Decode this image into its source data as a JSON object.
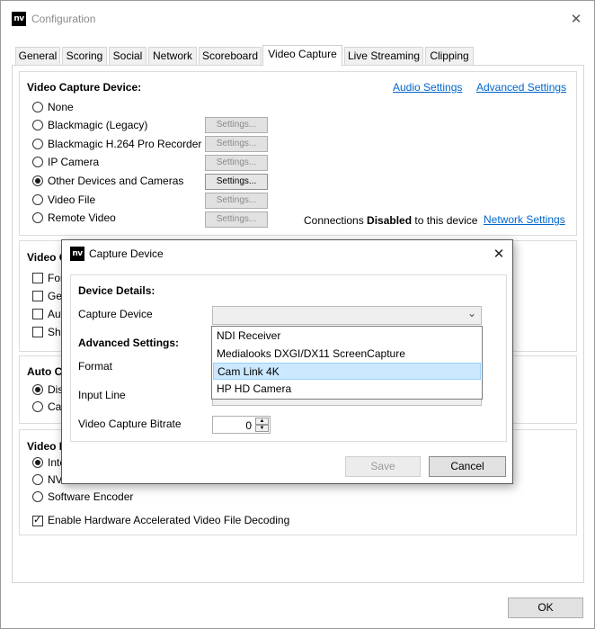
{
  "window": {
    "logo": "nv",
    "title": "Configuration",
    "close_icon": "✕"
  },
  "tabs": [
    "General",
    "Scoring",
    "Social",
    "Network",
    "Scoreboard",
    "Video Capture",
    "Live Streaming",
    "Clipping"
  ],
  "active_tab": "Video Capture",
  "video_capture_device": {
    "title": "Video Capture Device:",
    "audio_settings_link": "Audio Settings",
    "advanced_settings_link": "Advanced Settings",
    "options": [
      {
        "label": "None",
        "selected": false,
        "settings": ""
      },
      {
        "label": "Blackmagic (Legacy)",
        "selected": false,
        "settings": "Settings..."
      },
      {
        "label": "Blackmagic H.264 Pro Recorder",
        "selected": false,
        "settings": "Settings..."
      },
      {
        "label": "IP Camera",
        "selected": false,
        "settings": "Settings..."
      },
      {
        "label": "Other Devices and Cameras",
        "selected": true,
        "settings": "Settings..."
      },
      {
        "label": "Video File",
        "selected": false,
        "settings": "Settings..."
      },
      {
        "label": "Remote Video",
        "selected": false,
        "settings": "Settings..."
      }
    ],
    "connections_prefix": "Connections ",
    "connections_status": "Disabled",
    "connections_suffix": " to this device",
    "network_settings_link": "Network Settings"
  },
  "video_group": {
    "title_visible": "Video C",
    "checkboxes": [
      {
        "label": "For",
        "checked": false
      },
      {
        "label": "Gen",
        "checked": false
      },
      {
        "label": "Aut",
        "checked": false
      },
      {
        "label": "Sho",
        "checked": false
      }
    ]
  },
  "auto_group": {
    "title_visible": "Auto C",
    "radios": [
      {
        "label": "Dis",
        "selected": true
      },
      {
        "label": "Cap",
        "selected": false
      }
    ]
  },
  "encoder_group": {
    "title_visible": "Video E",
    "radios": [
      {
        "label": "Inte",
        "selected": true
      },
      {
        "label": "NV",
        "selected": false
      },
      {
        "label": "Software Encoder",
        "selected": false
      }
    ],
    "hw_decode_label": "Enable Hardware Accelerated Video File Decoding",
    "hw_decode_checked": true
  },
  "ok_button": "OK",
  "dialog": {
    "logo": "nv",
    "title": "Capture Device",
    "close_icon": "✕",
    "device_details_title": "Device Details:",
    "capture_device_label": "Capture Device",
    "capture_device_value": "",
    "dropdown_arrow": "⌄",
    "advanced_settings_title": "Advanced Settings:",
    "format_label": "Format",
    "input_line_label": "Input Line",
    "bitrate_label": "Video Capture Bitrate",
    "bitrate_value": "0",
    "spin_up": "▲",
    "spin_down": "▼",
    "save_button": "Save",
    "cancel_button": "Cancel",
    "dropdown_items": [
      "NDI Receiver",
      "Medialooks DXGI/DX11 ScreenCapture",
      "Cam Link 4K",
      "HP HD Camera"
    ],
    "dropdown_highlighted": "Cam Link 4K"
  }
}
